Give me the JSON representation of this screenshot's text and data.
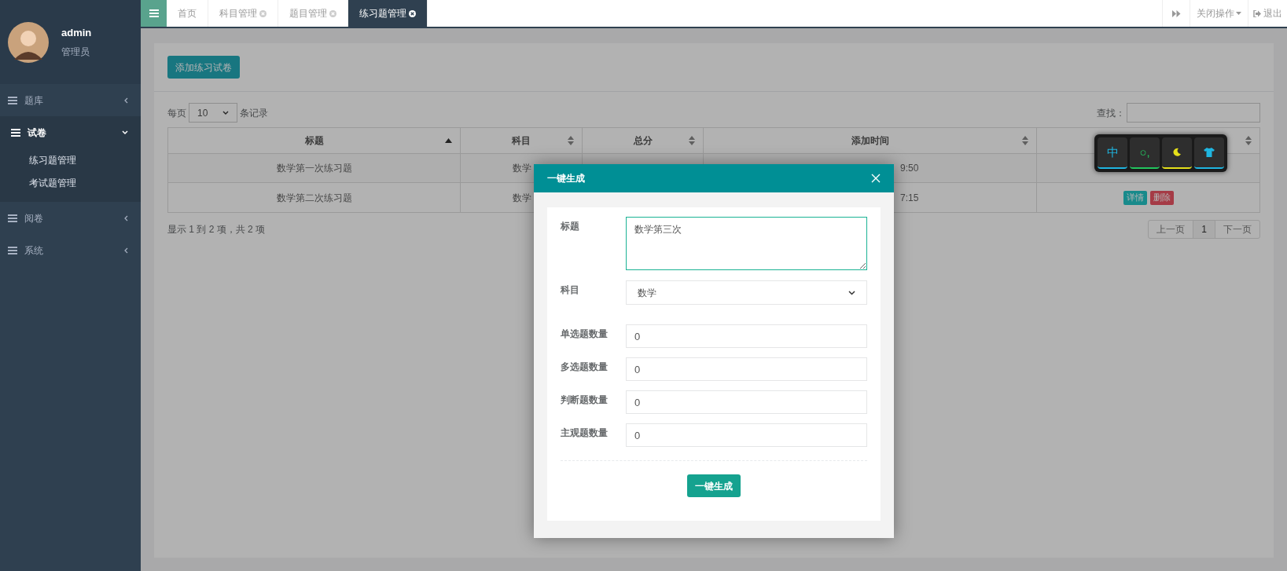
{
  "sidebar": {
    "user": {
      "name": "admin",
      "role": "管理员"
    },
    "items": [
      {
        "label": "题库",
        "expanded": false
      },
      {
        "label": "试卷",
        "expanded": true,
        "children": [
          {
            "label": "练习题管理"
          },
          {
            "label": "考试题管理"
          }
        ]
      },
      {
        "label": "阅卷",
        "expanded": false
      },
      {
        "label": "系统",
        "expanded": false
      }
    ]
  },
  "top_bar": {
    "tabs": [
      {
        "label": "首页",
        "closable": false,
        "selected": false
      },
      {
        "label": "科目管理",
        "closable": true,
        "selected": false
      },
      {
        "label": "题目管理",
        "closable": true,
        "selected": false
      },
      {
        "label": "练习题管理",
        "closable": true,
        "selected": true
      }
    ],
    "close_menu": "关闭操作",
    "logout": "退出"
  },
  "page": {
    "add_button": "添加练习试卷",
    "page_size": {
      "prefix": "每页",
      "value": "10",
      "suffix": "条记录"
    },
    "search_label": "查找：",
    "table": {
      "columns": [
        {
          "label": "标题",
          "sorted": true
        },
        {
          "label": "科目",
          "sorted": false
        },
        {
          "label": "总分",
          "sorted": false
        },
        {
          "label": "添加时间",
          "sorted": false
        },
        {
          "sorted": false
        }
      ],
      "rows": [
        {
          "title": "数学第一次练习题",
          "subject": "数学",
          "time": "9:50"
        },
        {
          "title": "数学第二次练习题",
          "subject": "数学",
          "time": "7:15",
          "actions": [
            {
              "label": "详情",
              "kind": "info"
            },
            {
              "label": "删除",
              "kind": "danger"
            }
          ]
        }
      ]
    },
    "info": "显示 1 到 2 项，共 2 项",
    "pagination": [
      {
        "label": "上一页",
        "selected": false
      },
      {
        "label": "1",
        "selected": true
      },
      {
        "label": "下一页",
        "selected": false
      }
    ]
  },
  "dialog": {
    "title": "一键生成",
    "fields": [
      {
        "label": "标题",
        "kind": "textarea",
        "value": "数学第三次"
      },
      {
        "label": "科目",
        "kind": "select",
        "value": "数学"
      },
      {
        "label": "单选题数量",
        "kind": "number",
        "value": "0"
      },
      {
        "label": "多选题数量",
        "kind": "number",
        "value": "0"
      },
      {
        "label": "判断题数量",
        "kind": "number",
        "value": "0"
      },
      {
        "label": "主观题数量",
        "kind": "number",
        "value": "0"
      }
    ],
    "submit": "一键生成"
  },
  "ime_toolbar": {
    "keys": [
      {
        "kind": "text",
        "label": "中",
        "color": "#1fb5e0"
      },
      {
        "kind": "text",
        "label": "○,",
        "color": "#22c55e"
      },
      {
        "kind": "moon",
        "color": "#e5e01a"
      },
      {
        "kind": "shirt",
        "color": "#1fb5e0"
      }
    ]
  }
}
